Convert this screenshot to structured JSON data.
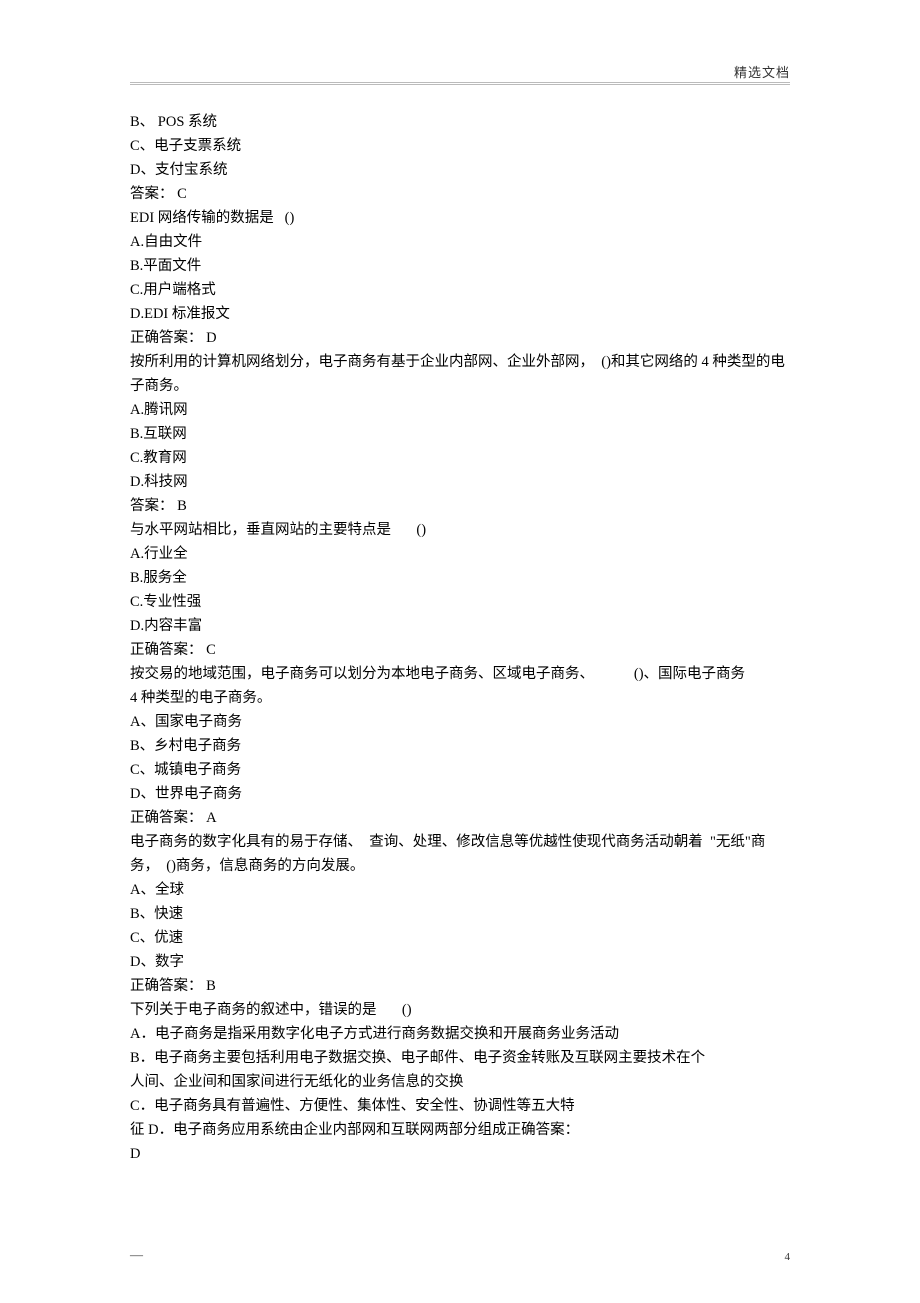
{
  "header": {
    "label": "精选文档"
  },
  "footer": {
    "dash": "—",
    "page_num": "4"
  },
  "lines": [
    "B、 POS 系统",
    "C、电子支票系统",
    "D、支付宝系统",
    "答案： C",
    "EDI 网络传输的数据是   ()",
    "A.自由文件",
    "B.平面文件",
    "C.用户端格式",
    "D.EDI 标准报文",
    "正确答案： D",
    "按所利用的计算机网络划分，电子商务有基于企业内部网、企业外部网，  ()和其它网络的 4 种类型的电子商务。",
    "A.腾讯网",
    "B.互联网",
    "C.教育网",
    "D.科技网",
    "答案： B",
    "与水平网站相比，垂直网站的主要特点是       ()",
    "A.行业全",
    "B.服务全",
    "C.专业性强",
    "D.内容丰富",
    "正确答案： C",
    "按交易的地域范围，电子商务可以划分为本地电子商务、区域电子商务、           ()、国际电子商务",
    "4 种类型的电子商务。",
    "A、国家电子商务",
    "B、乡村电子商务",
    "C、城镇电子商务",
    "D、世界电子商务",
    "正确答案： A",
    "电子商务的数字化具有的易于存储、  查询、处理、修改信息等优越性使现代商务活动朝着  \"无纸\"商务，  ()商务，信息商务的方向发展。",
    "A、全球",
    "B、快速",
    "C、优速",
    "D、数字",
    "正确答案： B",
    "下列关于电子商务的叙述中，错误的是       ()",
    "A．电子商务是指采用数字化电子方式进行商务数据交换和开展商务业务活动",
    "B．电子商务主要包括利用电子数据交换、电子邮件、电子资金转账及互联网主要技术在个",
    "人间、企业间和国家间进行无纸化的业务信息的交换",
    "C．电子商务具有普遍性、方便性、集体性、安全性、协调性等五大特",
    "征 D．电子商务应用系统由企业内部网和互联网两部分组成正确答案：",
    "D"
  ]
}
